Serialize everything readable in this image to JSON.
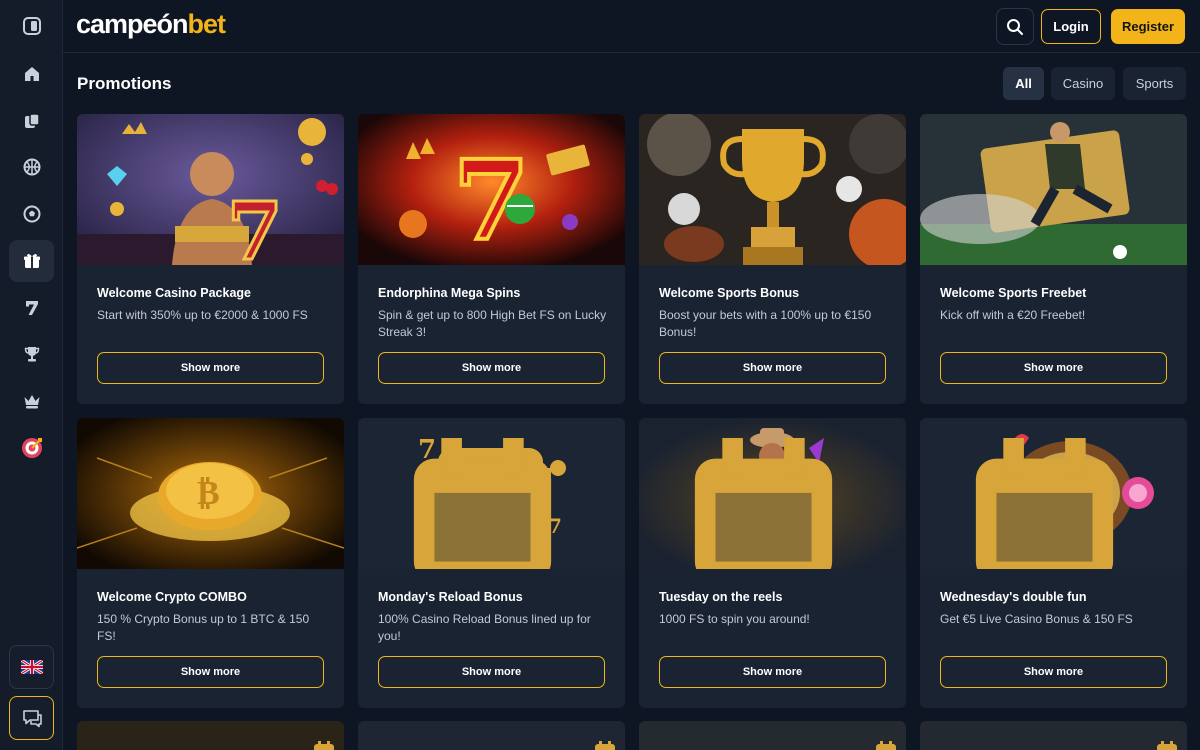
{
  "header": {
    "logo_main": "campeón",
    "logo_accent": "bet",
    "login_label": "Login",
    "register_label": "Register"
  },
  "page": {
    "title": "Promotions",
    "filters": [
      "All",
      "Casino",
      "Sports"
    ],
    "active_filter": "All"
  },
  "promotions": [
    {
      "title": "Welcome Casino Package",
      "description": "Start with 350% up to €2000 & 1000 FS",
      "button": "Show more",
      "image": "boxer-champion-777-slot"
    },
    {
      "title": "Endorphina Mega Spins",
      "description": "Spin & get up to 800 High Bet FS on Lucky Streak 3!",
      "button": "Show more",
      "image": "fiery-lucky-seven"
    },
    {
      "title": "Welcome Sports Bonus",
      "description": "Boost your bets with a 100% up to €150 Bonus!",
      "button": "Show more",
      "image": "golden-trophy-balls"
    },
    {
      "title": "Welcome Sports Freebet",
      "description": "Kick off with a €20 Freebet!",
      "button": "Show more",
      "image": "football-player-ticket"
    },
    {
      "title": "Welcome Crypto COMBO",
      "description": "150 % Crypto Bonus up to 1 BTC & 150 FS!",
      "button": "Show more",
      "image": "glowing-bitcoin-coin"
    },
    {
      "title": "Monday's Reload Bonus",
      "description": "100% Casino Reload Bonus lined up for you!",
      "button": "Show more",
      "image": "golden-slot-machine-777"
    },
    {
      "title": "Tuesday on the reels",
      "description": "1000 FS to spin you around!",
      "button": "Show more",
      "image": "cowboy-character-sevens"
    },
    {
      "title": "Wednesday's double fun",
      "description": "Get €5 Live Casino Bonus & 150 FS",
      "button": "Show more",
      "image": "roulette-gummy-bear"
    }
  ],
  "sidebar": {
    "items": [
      "toggle-sidebar",
      "home",
      "casino",
      "sports",
      "football",
      "promotions",
      "slots",
      "tournaments",
      "vip",
      "challenges"
    ],
    "active_item": "promotions",
    "language": "en-GB",
    "chat": "support-chat"
  },
  "colors": {
    "accent": "#f2b418",
    "background": "#0f1623",
    "card": "#1a2332",
    "sidebar": "#141c29"
  }
}
